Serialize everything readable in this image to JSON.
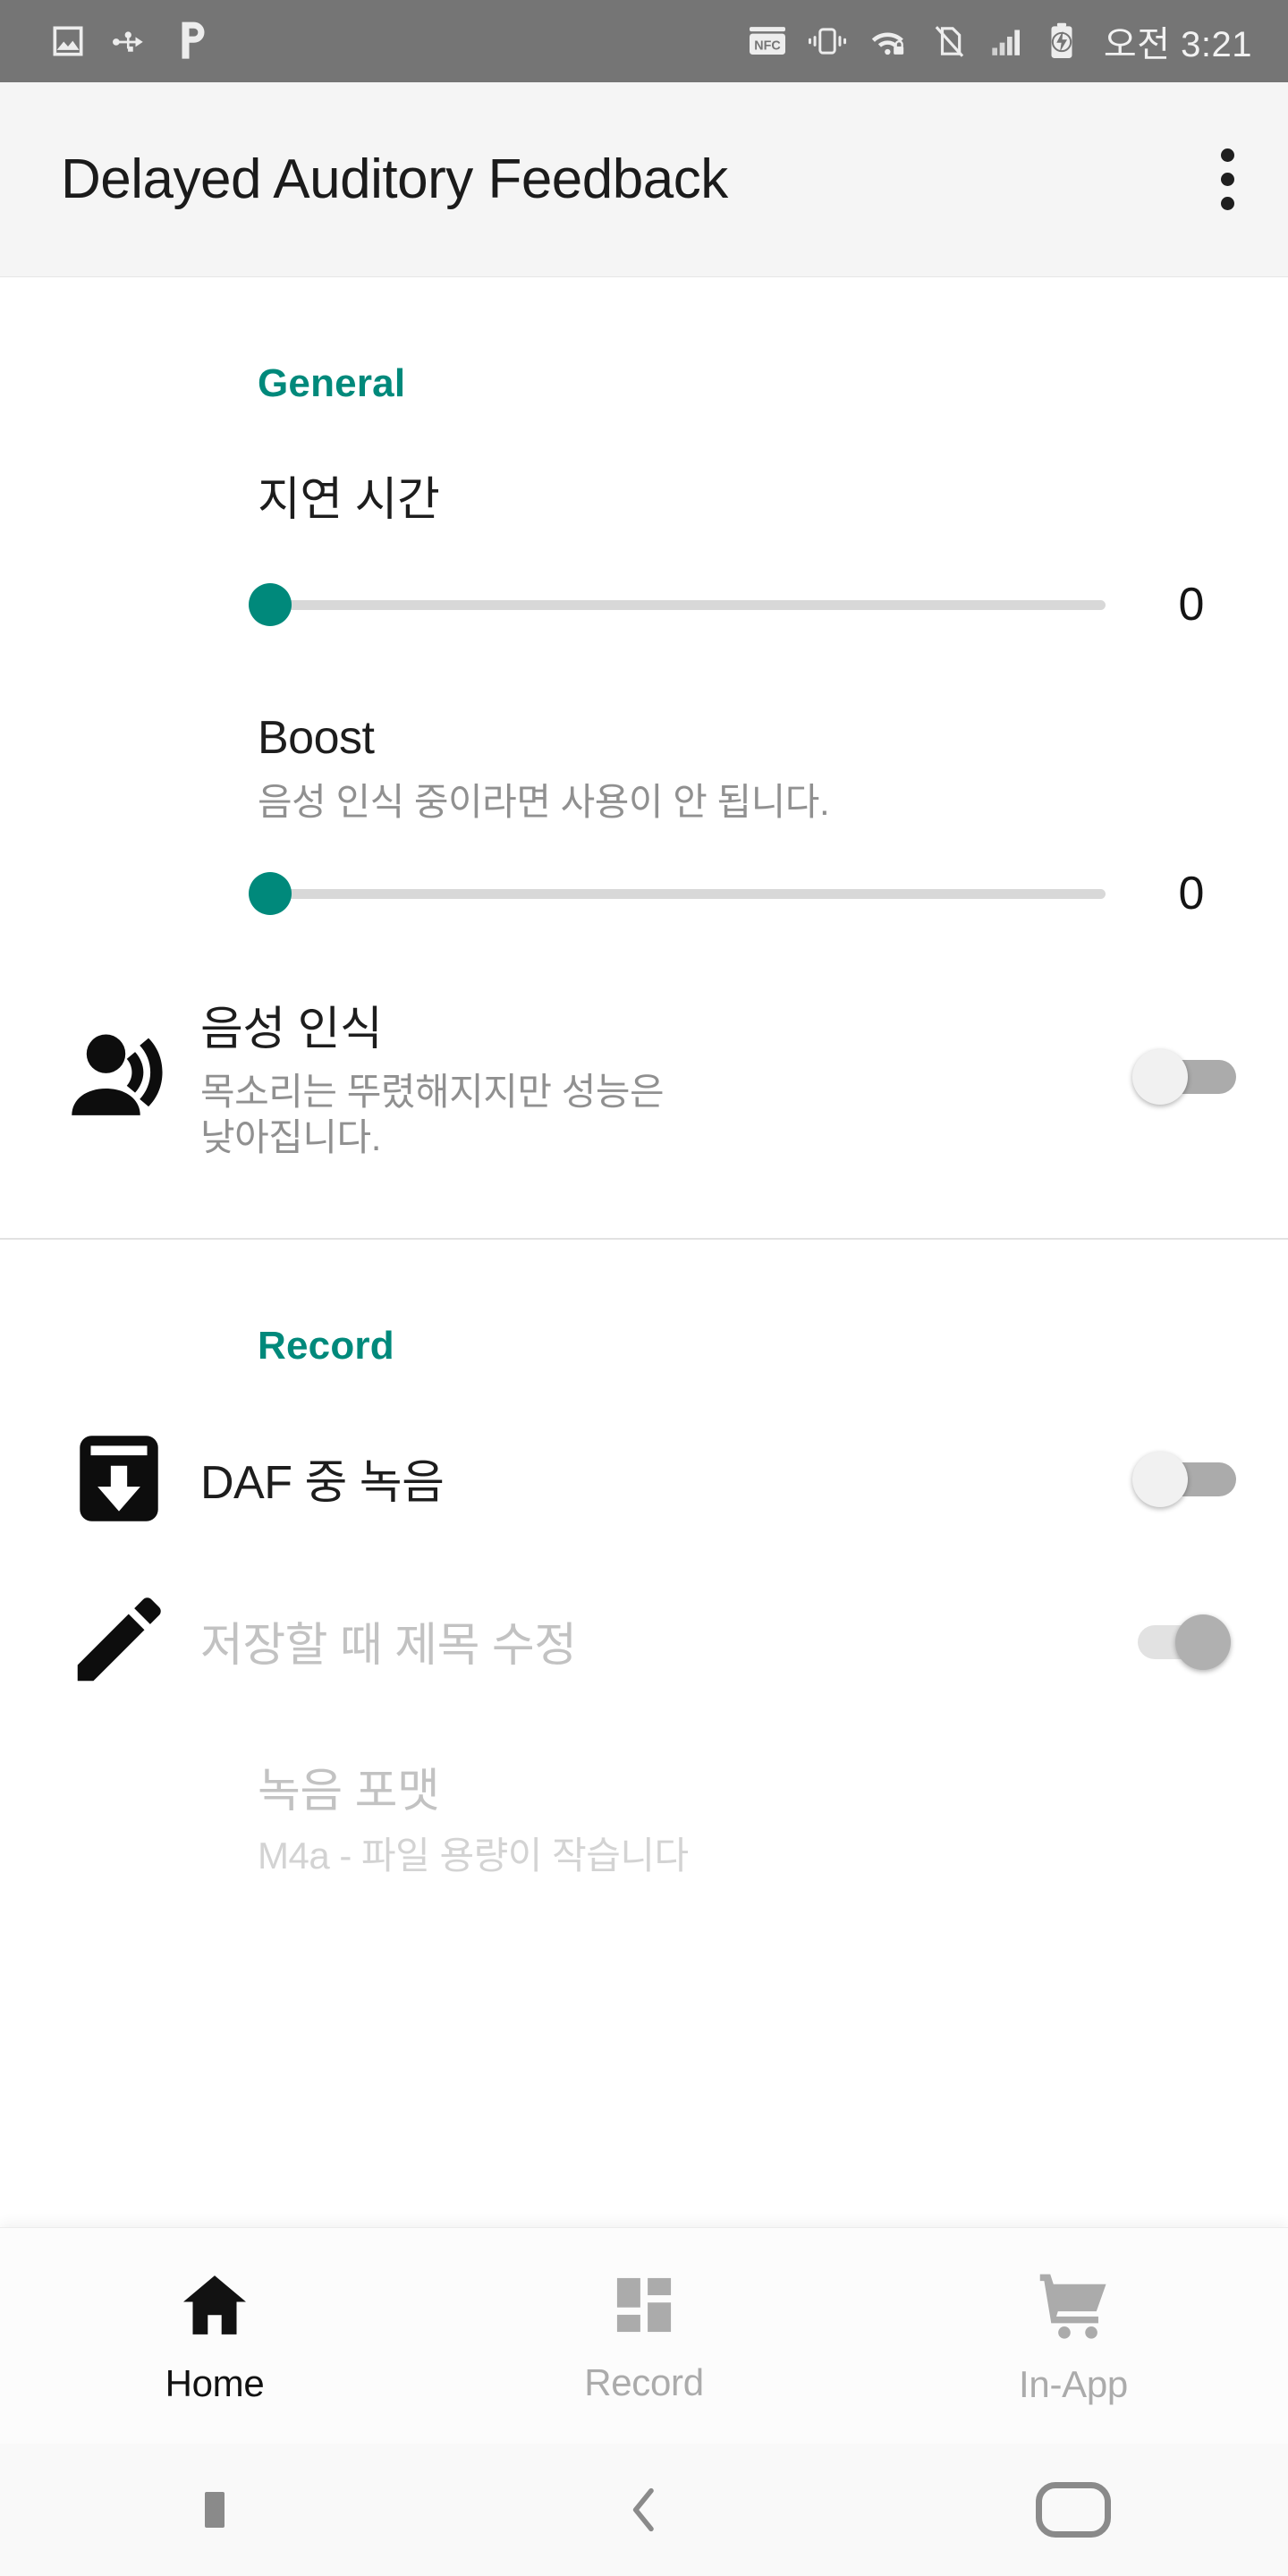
{
  "status_bar": {
    "left_icons": [
      "image-icon",
      "usb-icon",
      "p-app-icon"
    ],
    "right_icons": [
      "nfc-icon",
      "vibrate-icon",
      "wifi-lock-icon",
      "no-sim-icon",
      "signal-bars-icon",
      "battery-charging-icon"
    ],
    "time": "오전 3:21",
    "background": "#757575"
  },
  "app_bar": {
    "title": "Delayed Auditory Feedback",
    "overflow_label": "more-options",
    "background": "#f5f5f5"
  },
  "theme": {
    "accent": "#00897b",
    "title_color": "#1d1d1d",
    "subtitle_color": "#909090",
    "disabled_color": "#c2c2c2"
  },
  "sections": [
    {
      "header": "General",
      "items": [
        {
          "type": "slider",
          "title": "지연 시간",
          "subtitle": "",
          "value": "0",
          "percent": 0,
          "icon": ""
        },
        {
          "type": "slider",
          "title": "Boost",
          "subtitle": "음성 인식 중이라면 사용이 안 됩니다.",
          "value": "0",
          "percent": 0,
          "icon": ""
        },
        {
          "type": "switch",
          "title": "음성 인식",
          "subtitle_line1": "목소리는 뚜렸해지지만 성능은",
          "subtitle_line2": "낮아집니다.",
          "checked": false,
          "enabled": true,
          "icon": "record-voice-over-icon"
        }
      ]
    },
    {
      "header": "Record",
      "items": [
        {
          "type": "switch",
          "title": "DAF 중 녹음",
          "subtitle": "",
          "checked": false,
          "enabled": true,
          "icon": "save-download-box-icon"
        },
        {
          "type": "switch",
          "title": "저장할 때 제목 수정",
          "subtitle": "",
          "checked": true,
          "enabled": false,
          "icon": "edit-pencil-icon"
        },
        {
          "type": "list",
          "title": "녹음 포맷",
          "subtitle": "M4a - 파일 용량이 작습니다",
          "enabled": false,
          "icon": ""
        }
      ]
    }
  ],
  "bottom_nav": {
    "items": [
      {
        "label": "Home",
        "icon": "home-icon",
        "active": true
      },
      {
        "label": "Record",
        "icon": "dashboard-icon",
        "active": false
      },
      {
        "label": "In-App",
        "icon": "shopping-cart-icon",
        "active": false
      }
    ]
  },
  "system_nav": {
    "items": [
      {
        "label": "recents",
        "icon": "recents-square-icon"
      },
      {
        "label": "back",
        "icon": "back-chevron-icon"
      },
      {
        "label": "home",
        "icon": "home-pill-icon"
      }
    ]
  }
}
